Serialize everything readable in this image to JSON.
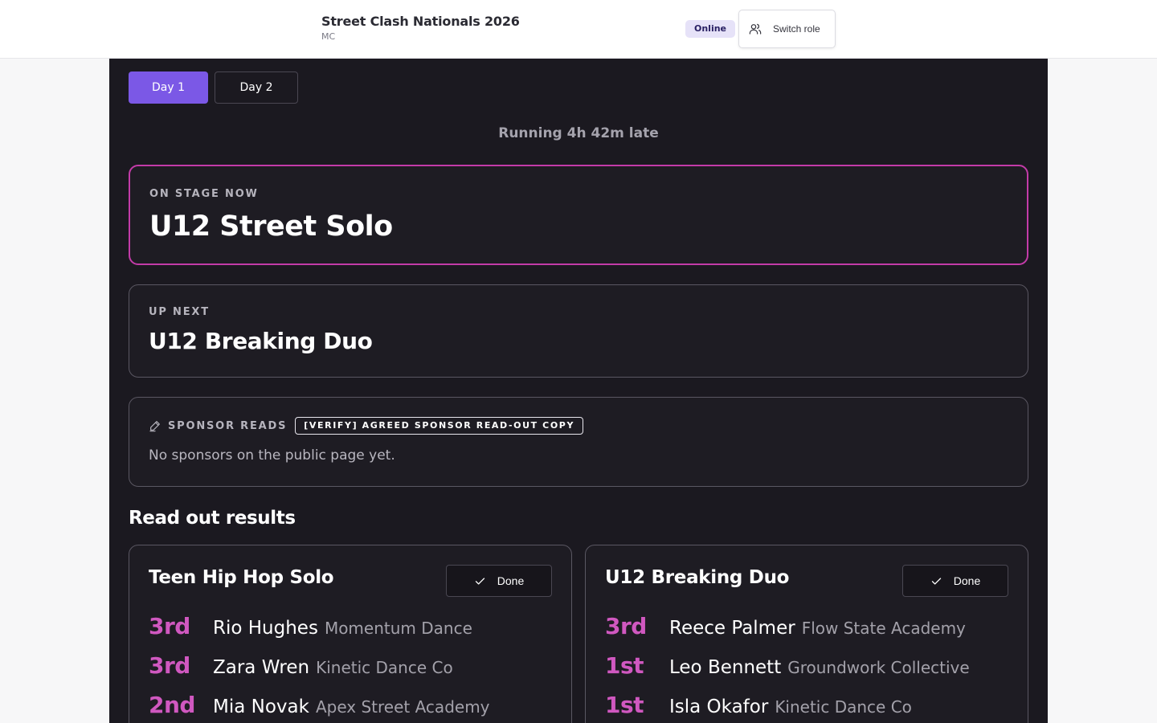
{
  "header": {
    "event_title": "Street Clash Nationals 2026",
    "role": "MC",
    "status": "Online",
    "switch_role_label": "Switch role"
  },
  "tabs": [
    {
      "label": "Day 1",
      "active": true
    },
    {
      "label": "Day 2",
      "active": false
    }
  ],
  "schedule": {
    "late_status": "Running 4h 42m late"
  },
  "on_stage": {
    "kicker": "ON STAGE NOW",
    "title": "U12 Street Solo"
  },
  "up_next": {
    "kicker": "UP NEXT",
    "title": "U12 Breaking Duo"
  },
  "sponsor": {
    "kicker": "SPONSOR READS",
    "verify_tag": "[VERIFY] AGREED SPONSOR READ-OUT COPY",
    "empty_text": "No sponsors on the public page yet."
  },
  "results": {
    "section_title": "Read out results",
    "cards": [
      {
        "title": "Teen Hip Hop Solo",
        "done_label": "Done",
        "placements": [
          {
            "place": "3rd",
            "dancer": "Rio Hughes",
            "studio": "Momentum Dance"
          },
          {
            "place": "3rd",
            "dancer": "Zara Wren",
            "studio": "Kinetic Dance Co"
          },
          {
            "place": "2nd",
            "dancer": "Mia Novak",
            "studio": "Apex Street Academy"
          }
        ]
      },
      {
        "title": "U12 Breaking Duo",
        "done_label": "Done",
        "placements": [
          {
            "place": "3rd",
            "dancer": "Reece Palmer",
            "studio": "Flow State Academy"
          },
          {
            "place": "1st",
            "dancer": "Leo Bennett",
            "studio": "Groundwork Collective"
          },
          {
            "place": "1st",
            "dancer": "Isla Okafor",
            "studio": "Kinetic Dance Co"
          }
        ]
      }
    ]
  },
  "colors": {
    "accent": "#7b58e6",
    "on_stage_border": "#c33ba8",
    "placement": "#d058c0",
    "panel_bg": "#1b1920"
  }
}
